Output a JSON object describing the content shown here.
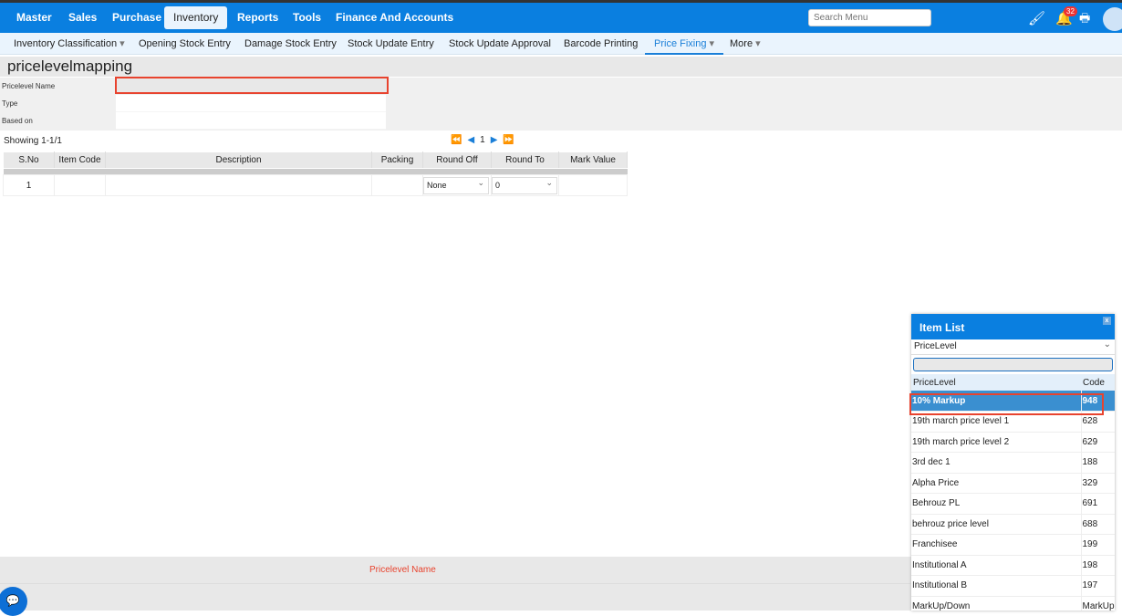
{
  "nav": {
    "items": [
      "Master",
      "Sales",
      "Purchase",
      "Inventory",
      "Reports",
      "Tools",
      "Finance And Accounts"
    ],
    "active": "Inventory",
    "search_placeholder": "Search Menu",
    "notification_count": "32",
    "icons": [
      "paint-brush-icon",
      "bell-icon",
      "printer-icon",
      "user-avatar-icon"
    ]
  },
  "subnav": {
    "items": [
      "Inventory Classification",
      "Opening Stock Entry",
      "Damage Stock Entry",
      "Stock Update Entry",
      "Stock Update Approval",
      "Barcode Printing",
      "Price Fixing",
      "More"
    ],
    "active": "Price Fixing"
  },
  "page": {
    "title": "pricelevelmapping",
    "fields": [
      {
        "label": "Pricelevel Name",
        "value": ""
      },
      {
        "label": "Type",
        "value": ""
      },
      {
        "label": "Based on",
        "value": ""
      }
    ]
  },
  "pager": {
    "showing": "Showing 1-1/1",
    "page": "1"
  },
  "table": {
    "headers": [
      "S.No",
      "Item Code",
      "Description",
      "Packing",
      "Round Off",
      "Round To",
      "Mark Value"
    ],
    "rows": [
      {
        "sno": "1",
        "item_code": "",
        "description": "",
        "packing": "",
        "round_off": "None",
        "round_to": "0",
        "mark_value": ""
      }
    ]
  },
  "footer": {
    "error": "Pricelevel Name"
  },
  "popup": {
    "title": "Item List",
    "close": "x",
    "select": "PriceLevel",
    "headers": [
      "PriceLevel",
      "Code"
    ],
    "rows": [
      {
        "name": "10% Markup",
        "code": "948"
      },
      {
        "name": "19th march price level 1",
        "code": "628"
      },
      {
        "name": "19th march price level 2",
        "code": "629"
      },
      {
        "name": "3rd dec 1",
        "code": "188"
      },
      {
        "name": "Alpha Price",
        "code": "329"
      },
      {
        "name": "Behrouz PL",
        "code": "691"
      },
      {
        "name": "behrouz price level",
        "code": "688"
      },
      {
        "name": "Franchisee",
        "code": "199"
      },
      {
        "name": "Institutional A",
        "code": "198"
      },
      {
        "name": "Institutional B",
        "code": "197"
      },
      {
        "name": "MarkUp/Down",
        "code": "MarkUp"
      }
    ],
    "selected": "10% Markup"
  },
  "colors": {
    "nav": "#0a7fe0",
    "highlight": "#e8432e",
    "selected_row": "#3a8fd0"
  }
}
